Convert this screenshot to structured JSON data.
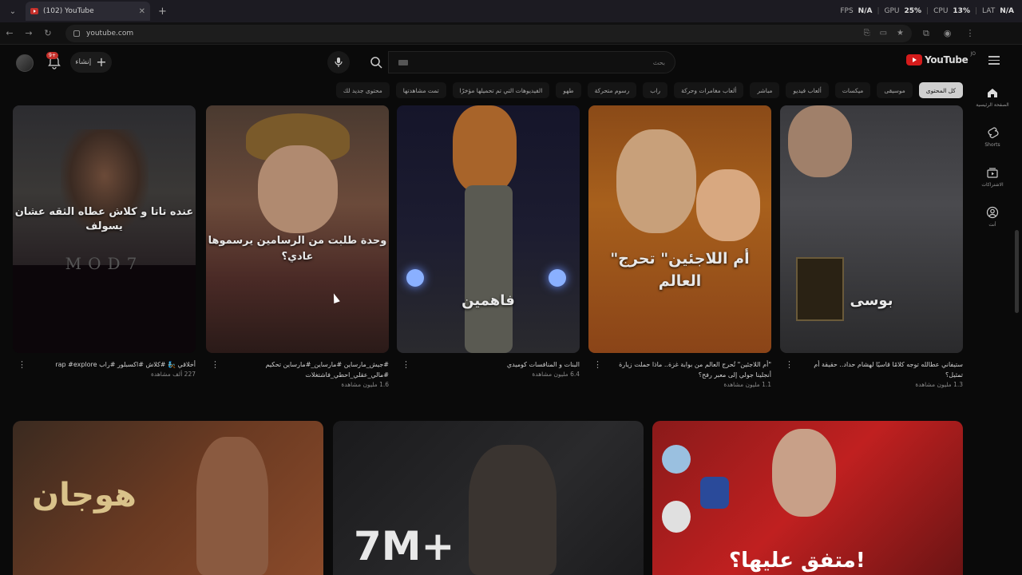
{
  "browser": {
    "tab_title": "(102) YouTube",
    "url": "youtube.com",
    "perf": {
      "fps_label": "FPS",
      "fps": "N/A",
      "gpu_label": "GPU",
      "gpu": "25%",
      "cpu_label": "CPU",
      "cpu": "13%",
      "lat_label": "LAT",
      "lat": "N/A"
    }
  },
  "header": {
    "logo_text": "YouTube",
    "logo_region": "JO",
    "search_placeholder": "بحث",
    "create_label": "إنشاء",
    "notification_count": "9+"
  },
  "chips": [
    "كل المحتوى",
    "موسيقى",
    "ميكسات",
    "ألعاب فيديو",
    "مباشر",
    "ألعاب مغامرات وحركة",
    "راب",
    "رسوم متحركة",
    "طهو",
    "الفيديوهات التي تم تحميلها مؤخرًا",
    "تمت مشاهدتها",
    "محتوى جديد لك"
  ],
  "sidebar": [
    {
      "label": "الصفحة الرئيسية",
      "icon": "home-icon"
    },
    {
      "label": "Shorts",
      "icon": "shorts-icon"
    },
    {
      "label": "الاشتراكات",
      "icon": "subscriptions-icon"
    },
    {
      "label": "أنت",
      "icon": "you-icon"
    }
  ],
  "shorts": [
    {
      "title": "ستيفاني عطالله توجه كلامًا قاسيًا لهشام حداد.. حقيقة أم تمثيل؟",
      "views": "1.3 مليون مشاهدة",
      "caption": "بوسى"
    },
    {
      "title": "\"أم اللاجئين\" تُحرج العالم من بوابة غزة.. ماذا حملت زيارة أنجلينا جولي إلى معبر رفح؟",
      "views": "1.1 مليون مشاهدة",
      "caption": "\"أم اللاجئين\" تحرج العالم"
    },
    {
      "title": "البنات و المنافسات كوميدي",
      "views": "6.4 مليون مشاهدة",
      "caption": "فاهمين"
    },
    {
      "title": "#جيش_مارساين #مارساين_#مارساين تحكيم #مالي_عقلي_احطي_فاشتغلات",
      "views": "1.6 مليون مشاهدة",
      "caption": "وحدة طلبت من الرسامين يرسموها عادي؟"
    },
    {
      "title": "أخلاقي 🧞 #كلاش #اكسبلور #راب rap #explore",
      "views": "227 ألف مشاهدة",
      "caption": "عنده تاتا و كلاش عطاه الثقه عشان يسولف"
    }
  ],
  "videos": [
    {
      "overlay": "متفق عليها؟!"
    },
    {
      "overlay": "7M+"
    },
    {
      "overlay": "هوجان"
    }
  ]
}
